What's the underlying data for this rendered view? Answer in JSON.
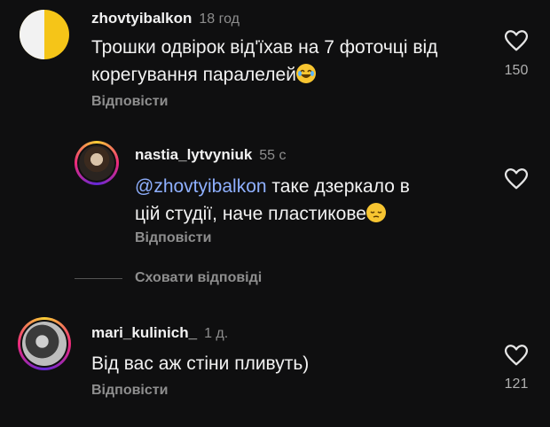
{
  "comments": [
    {
      "username": "zhovtyibalkon",
      "time": "18 год",
      "text_line1": "Трошки одвірок від'їхав на 7 фоточці від",
      "text_line2": "корегування паралелей",
      "emoji": "😂",
      "reply_label": "Відповісти",
      "likes": "150"
    },
    {
      "username": "nastia_lytvyniuk",
      "time": "55 с",
      "mention": "@zhovtyibalkon",
      "text_line1_rest": " таке дзеркало в",
      "text_line2": "цій студії, наче пластикове",
      "emoji": "😔",
      "reply_label": "Відповісти"
    },
    {
      "username": "mari_kulinich_",
      "time": "1 д.",
      "text_line1": "Від вас аж стіни пливуть)",
      "reply_label": "Відповісти",
      "likes": "121"
    }
  ],
  "hide_replies_label": "Сховати відповіді",
  "colors": {
    "background": "#0f0f10",
    "muted": "#8e8e8e",
    "mention": "#8fb0ff",
    "avatar_yellow": "#f5c518"
  }
}
